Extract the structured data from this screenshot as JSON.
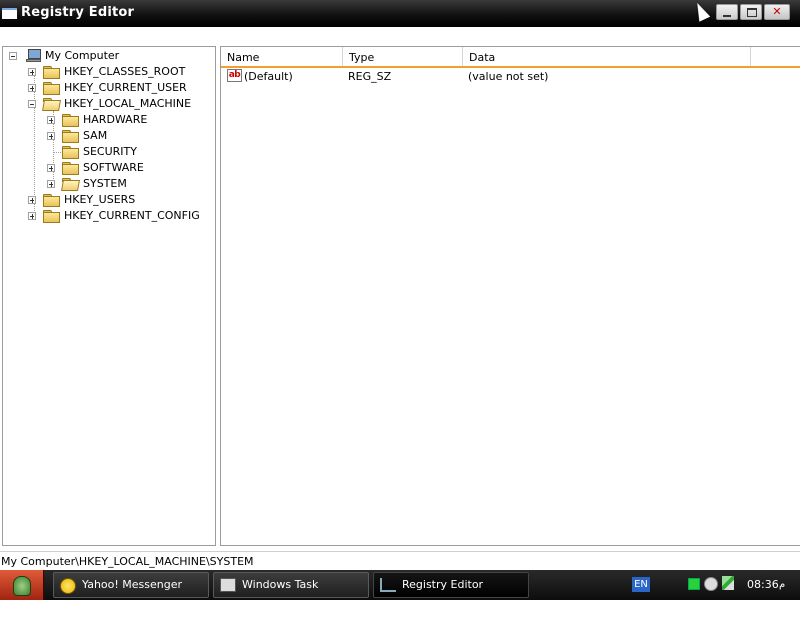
{
  "window": {
    "title": "Registry Editor"
  },
  "tree": {
    "root": "My Computer",
    "items": [
      {
        "label": "HKEY_CLASSES_ROOT",
        "expander": "plus"
      },
      {
        "label": "HKEY_CURRENT_USER",
        "expander": "plus"
      },
      {
        "label": "HKEY_LOCAL_MACHINE",
        "expander": "minus"
      },
      {
        "label": "HARDWARE",
        "expander": "plus"
      },
      {
        "label": "SAM",
        "expander": "plus"
      },
      {
        "label": "SECURITY",
        "expander": "none"
      },
      {
        "label": "SOFTWARE",
        "expander": "plus"
      },
      {
        "label": "SYSTEM",
        "expander": "plus",
        "selected": true
      },
      {
        "label": "HKEY_USERS",
        "expander": "plus"
      },
      {
        "label": "HKEY_CURRENT_CONFIG",
        "expander": "plus"
      }
    ]
  },
  "list": {
    "columns": [
      "Name",
      "Type",
      "Data"
    ],
    "rows": [
      {
        "name": "(Default)",
        "type": "REG_SZ",
        "data": "(value not set)",
        "icon": "string-value-icon"
      }
    ]
  },
  "statusbar": {
    "path": "My Computer\\HKEY_LOCAL_MACHINE\\SYSTEM"
  },
  "taskbar": {
    "tasks": [
      {
        "label": "Yahoo! Messenger",
        "icon": "yahoo-messenger-icon"
      },
      {
        "label": "Windows Task Manager",
        "icon": "task-manager-icon"
      },
      {
        "label": "Registry Editor",
        "icon": "registry-editor-icon",
        "active": true
      }
    ],
    "language": "EN",
    "clock": "08:36",
    "ampm": "م"
  },
  "colors": {
    "titlebar": "#000000",
    "header_accent": "#f0a030",
    "taskbar": "#111111",
    "start_button": "#c0391d"
  }
}
